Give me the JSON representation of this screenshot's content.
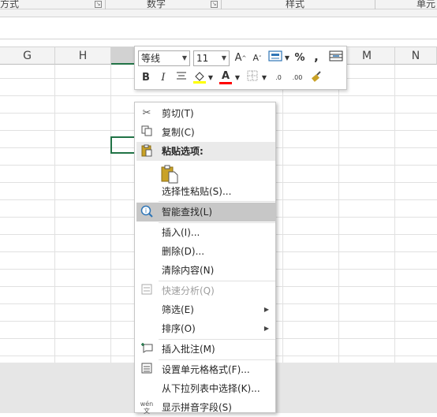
{
  "ribbon": {
    "groups": [
      "方式",
      "数字",
      "样式",
      "单元"
    ]
  },
  "columns": [
    "G",
    "H",
    "",
    "",
    "",
    "",
    "M",
    "N"
  ],
  "mini_toolbar": {
    "font_name": "等线",
    "font_size": "11",
    "grow_font": "A",
    "shrink_font": "A",
    "percent": "%",
    "comma": ",",
    "bold": "B",
    "italic": "I",
    "font_color_letter": "A",
    "decimal_more": ".00",
    "decimal_less": ".0",
    "accent_yellow": "#ffff00",
    "accent_red": "#ff0000"
  },
  "context_menu": {
    "cut": "剪切(T)",
    "copy": "复制(C)",
    "paste_options": "粘贴选项:",
    "paste_special": "选择性粘贴(S)...",
    "smart_lookup": "智能查找(L)",
    "insert": "插入(I)...",
    "delete": "删除(D)...",
    "clear_contents": "清除内容(N)",
    "quick_analysis": "快速分析(Q)",
    "filter": "筛选(E)",
    "sort": "排序(O)",
    "insert_comment": "插入批注(M)",
    "format_cells": "设置单元格格式(F)...",
    "pick_from_list": "从下拉列表中选择(K)...",
    "phonetic": "显示拼音字段(S)",
    "phonetic_icon_text": "wén"
  },
  "colors": {
    "excel_green": "#217346",
    "highlight": "#c7c7c7"
  }
}
